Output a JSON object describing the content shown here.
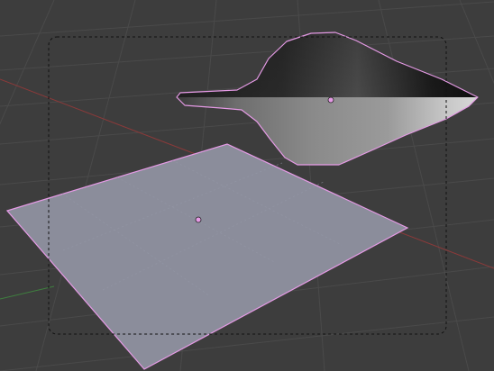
{
  "viewport": {
    "background_color": "#3d3d3d",
    "grid_color": "#4a4a4a",
    "x_axis_color": "#8a3a3a",
    "y_axis_color": "#3f7f3f",
    "selection_color": "#e59ae5",
    "camera_frame_color": "#111111"
  },
  "objects": [
    {
      "name": "plane",
      "type": "mesh",
      "selected": true,
      "fill_color": "#8b8d9b"
    },
    {
      "name": "curved-surface",
      "type": "mesh",
      "selected": true,
      "fill_color": "#6a6a6a"
    }
  ],
  "camera_frame": {
    "style": "dashed"
  }
}
